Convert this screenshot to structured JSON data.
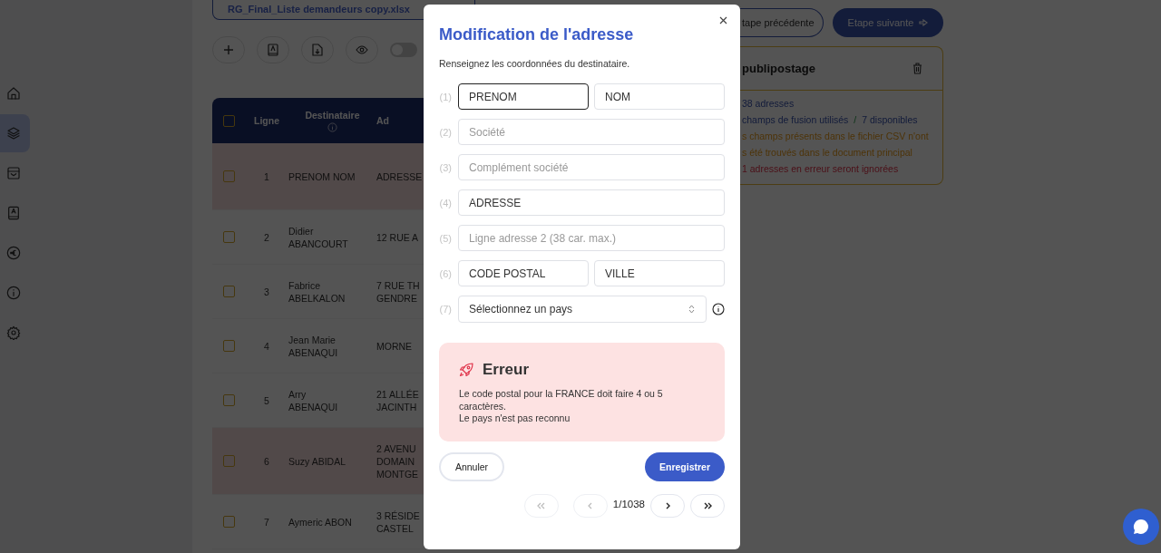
{
  "sidebar": {
    "items": [
      {
        "selected": false
      },
      {
        "selected": true
      },
      {
        "selected": false
      },
      {
        "selected": false
      },
      {
        "selected": false
      },
      {
        "selected": false
      },
      {
        "selected": false
      }
    ]
  },
  "file": {
    "name": "RG_Final_Liste demandeurs copy.xlsx"
  },
  "toolbar": {
    "toggle": {
      "on": false
    }
  },
  "table": {
    "header_checked": false,
    "columns": [
      "Ligne",
      "Destinataire",
      "Ad"
    ],
    "rows": [
      {
        "checked": false,
        "error": true,
        "line": "1",
        "recipient": [
          "PRENOM NOM"
        ],
        "address": [
          "ADRESSE"
        ]
      },
      {
        "checked": false,
        "error": false,
        "line": "2",
        "recipient": [
          "Didier",
          "ABANCOURT"
        ],
        "address": [
          "12 RUE A"
        ]
      },
      {
        "checked": false,
        "error": false,
        "line": "3",
        "recipient": [
          "Fabrice",
          "ABELKALON"
        ],
        "address": [
          "7 RUE TH",
          "GENDRE"
        ]
      },
      {
        "checked": false,
        "error": false,
        "line": "4",
        "recipient": [
          "Jean Marie",
          "ABENAQUI"
        ],
        "address": [
          "MORNE"
        ]
      },
      {
        "checked": false,
        "error": false,
        "line": "5",
        "recipient": [
          "Arry",
          "ABENAQUI"
        ],
        "address": [
          "21 ALLÉE",
          "JACINTH"
        ]
      },
      {
        "checked": false,
        "error": true,
        "line": "6",
        "recipient": [
          "Suzy ABIDAL"
        ],
        "address": [
          "2 AVENU",
          "DOMAIN",
          "MONTGE"
        ]
      },
      {
        "checked": false,
        "error": false,
        "line": "7",
        "recipient": [
          "Aymeric ABON"
        ],
        "address": [
          "3 RÉSIDE",
          "CASTEL"
        ]
      }
    ]
  },
  "steps": {
    "previous": "tape précédente",
    "next": "Etape suivante"
  },
  "summary": {
    "title": "publipostage",
    "lines": [
      {
        "kind": "info",
        "text": "38 adresses"
      },
      {
        "kind": "ratio",
        "used": "champs de fusion utilisés",
        "separator": "/",
        "available": "7 disponibles"
      },
      {
        "kind": "warning",
        "text": "s champs présents dans le fichier CSV n'ont"
      },
      {
        "kind": "warning",
        "text": "s été trouvés dans le document principal"
      },
      {
        "kind": "error",
        "text": "1 adresses en erreur seront ignorées"
      }
    ]
  },
  "modal": {
    "title": "Modification de l'adresse",
    "subtitle": "Renseignez les coordonnées du destinataire.",
    "rows": [
      {
        "kind": "fields",
        "number": "(1)",
        "fields": [
          {
            "value": "PRENOM",
            "focused": true
          },
          {
            "value": "NOM",
            "focused": false
          }
        ]
      },
      {
        "kind": "fields",
        "number": "(2)",
        "fields": [
          {
            "placeholder": "Société",
            "focused": false
          }
        ]
      },
      {
        "kind": "fields",
        "number": "(3)",
        "fields": [
          {
            "placeholder": "Complément société",
            "focused": false
          }
        ]
      },
      {
        "kind": "fields",
        "number": "(4)",
        "fields": [
          {
            "value": "ADRESSE",
            "focused": false
          }
        ]
      },
      {
        "kind": "fields",
        "number": "(5)",
        "fields": [
          {
            "placeholder": "Ligne adresse 2 (38 car. max.)",
            "focused": false
          }
        ]
      },
      {
        "kind": "fields",
        "number": "(6)",
        "fields": [
          {
            "value": "CODE POSTAL",
            "focused": false
          },
          {
            "value": "VILLE",
            "focused": false
          }
        ]
      },
      {
        "kind": "select",
        "number": "(7)",
        "value": "Sélectionnez un pays"
      }
    ],
    "error": {
      "title": "Erreur",
      "lines": [
        "Le code postal pour la FRANCE doit faire 4 ou 5 caractères.",
        "Le pays n'est pas reconnu"
      ]
    },
    "cancel": "Annuler",
    "save": "Enregistrer",
    "pager": {
      "first_disabled": true,
      "prev_disabled": true,
      "position": "1/1038",
      "next_disabled": false,
      "last_disabled": false
    }
  }
}
